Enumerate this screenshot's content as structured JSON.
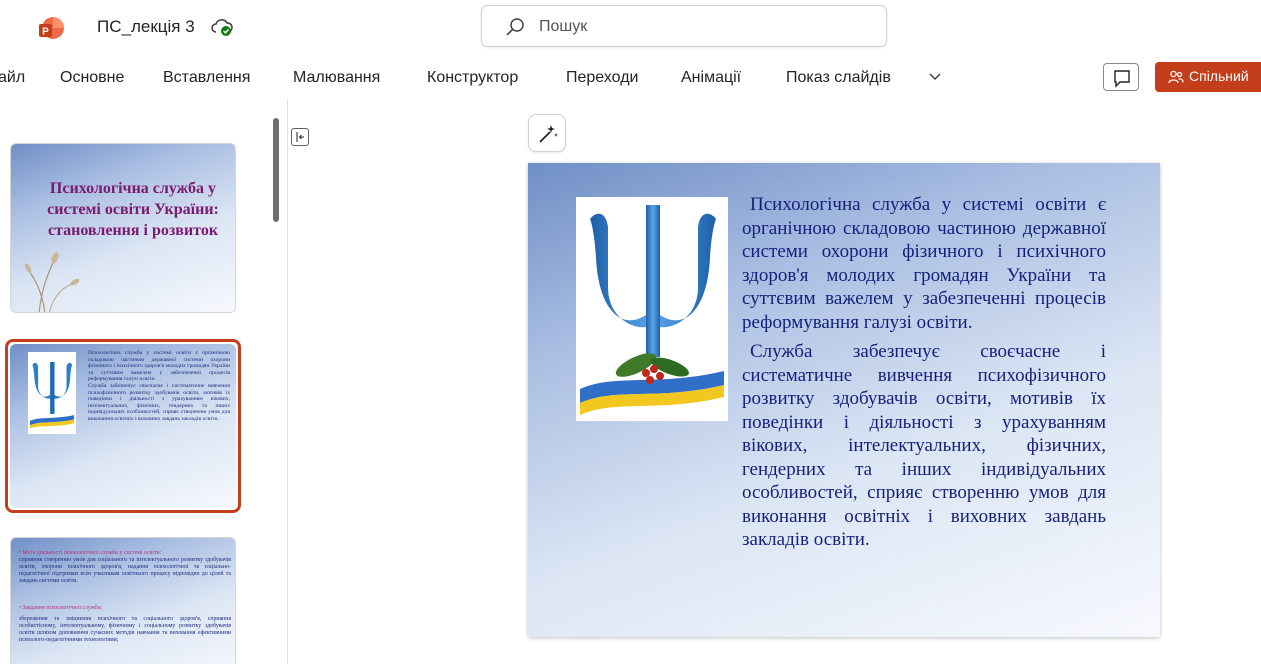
{
  "titlebar": {
    "document_title": "ПС_лекція 3",
    "search_placeholder": "Пошук",
    "brand_color": "#c43e1c"
  },
  "ribbon": {
    "tabs": [
      "айл",
      "Основне",
      "Вставлення",
      "Малювання",
      "Конструктор",
      "Переходи",
      "Анімації",
      "Показ слайдів"
    ],
    "share_label": "Спільний"
  },
  "thumbnails": {
    "slide1_title": "Психологічна служба у системі освіти України: становлення і розвиток",
    "slide3_goal_heading": "• Мета діяльності психологічної служби у системі освіти:",
    "slide3_goal_text": "сприяння створенню умов для соціального та інтелектуального розвитку здобувачів освіти, охорони психічного здоров'я, надання психологічної та соціально-педагогічної підтримки всім учасникам освітнього процесу відповідно до цілей та завдань системи освіти.",
    "slide3_tasks_heading": "• Завдання психологічної служби:",
    "slide3_tasks_text": "збереження та зміцнення психічного та соціального здоров'я, сприяння особистісному, інтелектуальному, фізичному і соціальному розвитку здобувачів освіти шляхом доповнення сучасних методів навчання та виховання ефективними психолого-педагогічними технологіями;"
  },
  "slide": {
    "paragraph1": "Психологічна служба у системі освіти є органічною складовою частиною державної системи охорони фізичного і психічного здоров'я молодих громадян України та суттєвим важелем у забезпеченні процесів реформування галузі освіти.",
    "paragraph2": "Служба забезпечує своєчасне і систематичне вивчення психофізичного розвитку здобувачів освіти, мотивів їх поведінки і діяльності з урахуванням вікових, інтелектуальних, фізичних, гендерних та інших індивідуальних особливостей, сприяє створенню умов для виконання освітніх і виховних завдань закладів освіти."
  }
}
